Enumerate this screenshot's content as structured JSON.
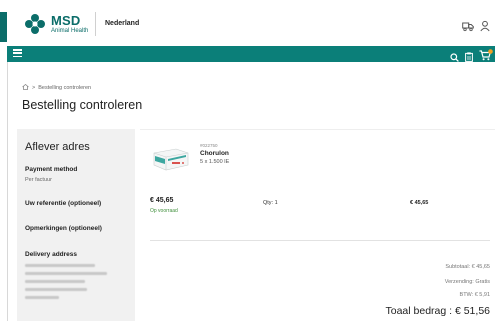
{
  "header": {
    "brand": "MSD",
    "brand_sub": "Animal Health",
    "region": "Nederland",
    "brand_color": "#0b6d69"
  },
  "nav": {
    "color": "#0b7f79",
    "icons": [
      "menu-icon",
      "search-icon",
      "clipboard-icon",
      "cart-icon"
    ],
    "cart_badge_color": "#f0a020"
  },
  "breadcrumb": {
    "home_icon": "home-icon",
    "separator": ">",
    "current": "Bestelling controleren"
  },
  "page": {
    "title": "Bestelling controleren"
  },
  "delivery": {
    "heading": "Aflever adres",
    "payment_label": "Payment method",
    "payment_value": "Per factuur",
    "reference_label": "Uw referentie (optioneel)",
    "remarks_label": "Opmerkingen (optioneel)",
    "address_label": "Delivery address"
  },
  "order": {
    "items": [
      {
        "sku": "#022750",
        "name": "Chorulon",
        "pack": "5 x 1.500 IE",
        "price": "€ 45,65",
        "stock": "Op voorraad",
        "qty": "Qty: 1",
        "total": "€ 45,65"
      }
    ],
    "summary": {
      "subtotal": "Subtotaal: € 45,65",
      "shipping": "Verzending: Gratis",
      "vat": "BTW: € 5,91",
      "total": "Toaal bedrag :  € 51,56"
    }
  }
}
